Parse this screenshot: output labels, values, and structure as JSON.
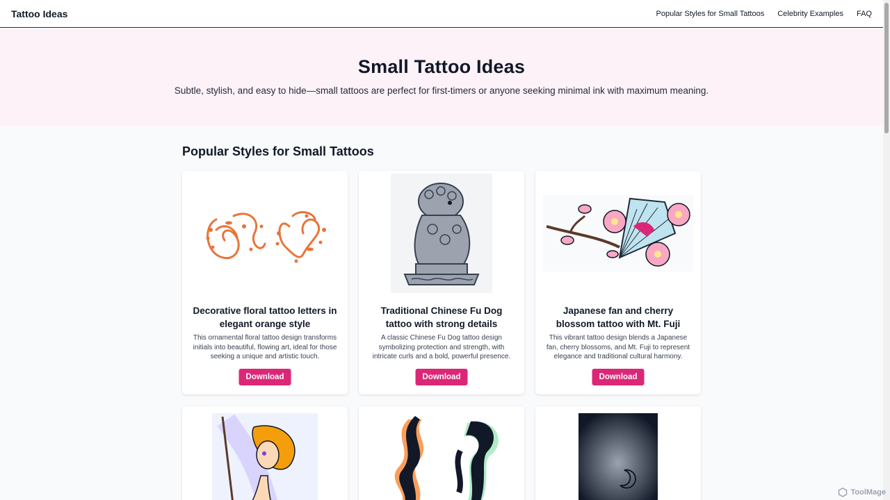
{
  "nav": {
    "brand": "Tattoo Ideas",
    "links": [
      "Popular Styles for Small Tattoos",
      "Celebrity Examples",
      "FAQ"
    ]
  },
  "hero": {
    "title": "Small Tattoo Ideas",
    "subtitle": "Subtle, stylish, and easy to hide—small tattoos are perfect for first-timers or anyone seeking minimal ink with maximum meaning."
  },
  "section": {
    "title": "Popular Styles for Small Tattoos"
  },
  "cards": [
    {
      "title": "Decorative floral tattoo letters in elegant orange style",
      "description": "This ornamental floral tattoo design transforms initials into beautiful, flowing art, ideal for those seeking a unique and artistic touch.",
      "button": "Download"
    },
    {
      "title": "Traditional Chinese Fu Dog tattoo with strong details",
      "description": "A classic Chinese Fu Dog tattoo design symbolizing protection and strength, with intricate curls and a bold, powerful presence.",
      "button": "Download"
    },
    {
      "title": "Japanese fan and cherry blossom tattoo with Mt. Fuji",
      "description": "This vibrant tattoo design blends a Japanese fan, cherry blossoms, and Mt. Fuji to represent elegance and traditional cultural harmony.",
      "button": "Download"
    }
  ],
  "watermark": "ToolMage",
  "colors": {
    "accent": "#db2777",
    "hero_bg": "#fdf2f8",
    "page_bg": "#f9fafb"
  }
}
